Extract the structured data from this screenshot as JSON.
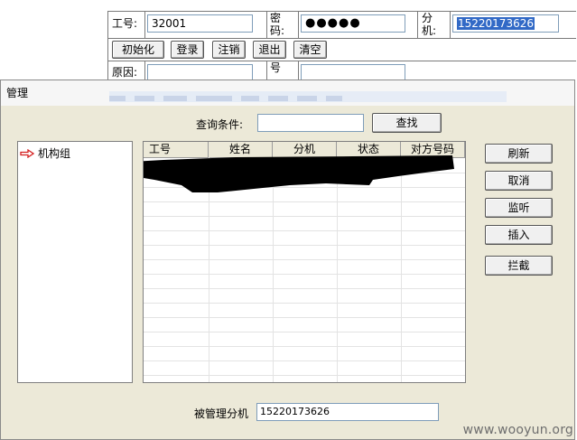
{
  "login_form": {
    "employee_id_label": "工号:",
    "employee_id_value": "32001",
    "password_label_line1": "密",
    "password_label_line2": "码:",
    "password_value": "●●●●●",
    "extension_label_line1": "分",
    "extension_label_line2": "机:",
    "extension_value": "15220173626",
    "reason_label": "原因:",
    "number_label_partial": "号",
    "buttons": {
      "init": "初始化",
      "login": "登录",
      "logout": "注销",
      "exit": "退出",
      "clear": "清空"
    }
  },
  "dialog": {
    "title": "管理",
    "query_label": "查询条件:",
    "query_value": "",
    "find_button": "查找",
    "tree_root": "机构组",
    "table": {
      "columns": [
        "工号",
        "姓名",
        "分机",
        "状态",
        "对方号码"
      ]
    },
    "side_buttons": {
      "refresh": "刷新",
      "cancel": "取消",
      "monitor": "监听",
      "insert": "插入",
      "intercept": "拦截"
    },
    "managed_ext_label": "被管理分机",
    "managed_ext_value": "15220173626"
  },
  "watermark": "www.wooyun.org",
  "colors": {
    "dialog_bg": "#ece9d8",
    "selection": "#3169c6",
    "redaction": "#000000"
  }
}
